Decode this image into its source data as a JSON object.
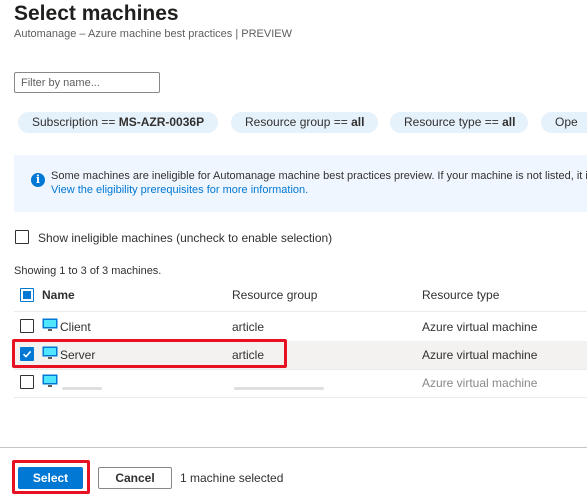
{
  "header": {
    "title": "Select machines",
    "subtitle": "Automanage – Azure machine best practices | PREVIEW"
  },
  "filter": {
    "placeholder": "Filter by name..."
  },
  "pills": [
    {
      "key": "Subscription == ",
      "value": "MS-AZR-0036P"
    },
    {
      "key": "Resource group == ",
      "value": "all"
    },
    {
      "key": "Resource type == ",
      "value": "all"
    },
    {
      "key": "Ope",
      "value": ""
    }
  ],
  "info": {
    "text": "Some machines are ineligible for Automanage machine best practices preview. If your machine is not listed, it is",
    "link": "View the eligibility prerequisites for more information."
  },
  "show_ineligible_label": "Show ineligible machines (uncheck to enable selection)",
  "showing_text": "Showing 1 to 3 of 3 machines.",
  "table": {
    "columns": [
      "Name",
      "Resource group",
      "Resource type"
    ],
    "rows": [
      {
        "name": "Client",
        "group": "article",
        "type": "Azure virtual machine",
        "checked": false
      },
      {
        "name": "Server",
        "group": "article",
        "type": "Azure virtual machine",
        "checked": true
      },
      {
        "name": "",
        "group": "",
        "type": "Azure virtual machine",
        "checked": false
      }
    ]
  },
  "footer": {
    "select_label": "Select",
    "cancel_label": "Cancel",
    "selected_text": "1 machine selected"
  },
  "colors": {
    "accent": "#0078d4",
    "highlight": "#e81123",
    "pill_bg": "#e5f1fb",
    "info_bg": "#f0f6ff"
  },
  "icons": [
    "info-icon",
    "virtual-machine-icon",
    "checkmark-icon"
  ]
}
